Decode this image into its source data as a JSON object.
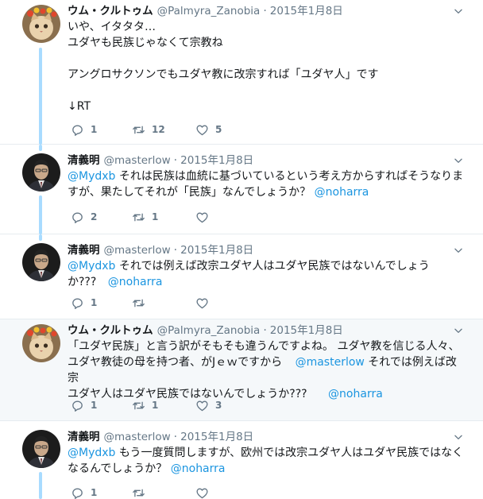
{
  "tweets": [
    {
      "name": "ウム・クルトゥム",
      "handle": "@Palmyra_Zanobia",
      "sep": "·",
      "time": "2015年1月8日",
      "lines": [
        "いや、イタタタ…",
        "ユダヤも民族じゃなくて宗教ね",
        "",
        "アングロサクソンでもユダヤ教に改宗すれば「ユダヤ人」です",
        "",
        "↓RT"
      ],
      "replies": "1",
      "retweets": "12",
      "likes": "5",
      "avatar": "cat-avatar"
    },
    {
      "name": "清義明",
      "handle": "@masterlow",
      "sep": "·",
      "time": "2015年1月8日",
      "l1_m1": "@Mydxb",
      "l1_t1": " それは民族は血統に基づいているという考え方からすればそうなりま",
      "l2_t1": "すが、果たしてそれが「民族」なんでしょうか？ ",
      "l2_m1": "@noharra",
      "replies": "2",
      "retweets": "1",
      "likes": "",
      "avatar": "man-avatar"
    },
    {
      "name": "清義明",
      "handle": "@masterlow",
      "sep": "·",
      "time": "2015年1月8日",
      "l1_m1": "@Mydxb",
      "l1_t1": " それでは例えば改宗ユダヤ人はユダヤ民族ではないんでしょう",
      "l2_t1": "か??? ",
      "l2_m1": "@noharra",
      "replies": "1",
      "retweets": "",
      "likes": "",
      "avatar": "man-avatar"
    },
    {
      "name": "ウム・クルトゥム",
      "handle": "@Palmyra_Zanobia",
      "sep": "·",
      "time": "2015年1月8日",
      "l1_t1": "「ユダヤ民族」と言う訳がそもそも違うんですよね。 ユダヤ教を信じる人々、",
      "l2_t1": "ユダヤ教徒の母を持つ者、がJｅｗですから ",
      "l2_m1": "@masterlow",
      "l2_t2": " それでは例えば改宗",
      "l3_t1": "ユダヤ人はユダヤ民族ではないんでしょうか??? ",
      "l3_m1": "@noharra",
      "replies": "1",
      "retweets": "1",
      "likes": "3",
      "avatar": "cat-avatar"
    },
    {
      "name": "清義明",
      "handle": "@masterlow",
      "sep": "·",
      "time": "2015年1月8日",
      "l1_m1": "@Mydxb",
      "l1_t1": " もう一度質問しますが、欧州では改宗ユダヤ人はユダヤ民族ではなく",
      "l2_t1": "なるんでしょうか？ ",
      "l2_m1": "@noharra",
      "replies": "1",
      "retweets": "",
      "likes": "",
      "avatar": "man-avatar"
    }
  ],
  "colors": {
    "accent": "#1b95e0",
    "thread_line": "#a8dbff",
    "secondary_text": "#657786",
    "highlight_bg": "#f5f8fa"
  }
}
